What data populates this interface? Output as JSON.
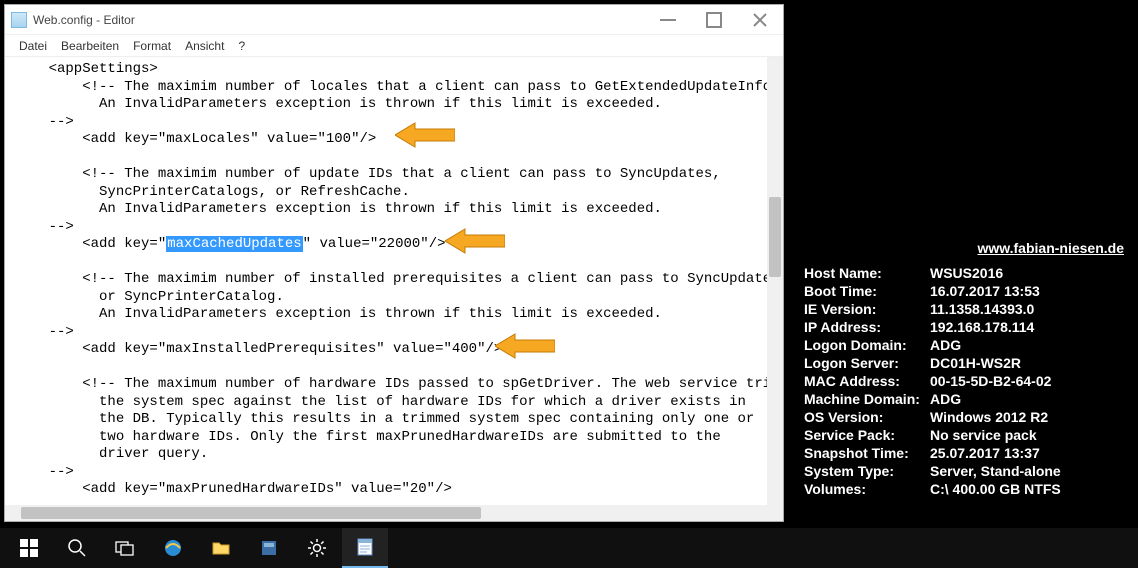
{
  "window": {
    "title": "Web.config - Editor",
    "menu": {
      "datei": "Datei",
      "bearbeiten": "Bearbeiten",
      "format": "Format",
      "ansicht": "Ansicht",
      "help": "?"
    }
  },
  "code": {
    "l1": "    <appSettings>",
    "l2": "        <!-- The maximim number of locales that a client can pass to GetExtendedUpdateInfo.",
    "l3": "          An InvalidParameters exception is thrown if this limit is exceeded.",
    "l4": "    -->",
    "l5a": "        <add key=\"maxLocales\" value=\"",
    "l5b": "100",
    "l5c": "\"/>",
    "l6": "",
    "l7": "        <!-- The maximim number of update IDs that a client can pass to SyncUpdates,",
    "l8": "          SyncPrinterCatalogs, or RefreshCache.",
    "l9": "          An InvalidParameters exception is thrown if this limit is exceeded.",
    "l10": "    -->",
    "l11a": "        <add key=\"",
    "l11b": "maxCachedUpdates",
    "l11c": "\" value=\"",
    "l11d": "22000",
    "l11e": "\"/>",
    "l12": "",
    "l13": "        <!-- The maximim number of installed prerequisites a client can pass to SyncUpdates",
    "l14": "          or SyncPrinterCatalog.",
    "l15": "          An InvalidParameters exception is thrown if this limit is exceeded.",
    "l16": "    -->",
    "l17a": "        <add key=\"maxInstalledPrerequisites\" value=\"",
    "l17b": "400",
    "l17c": "\"/>",
    "l18": "",
    "l19": "        <!-- The maximum number of hardware IDs passed to spGetDriver. The web service trims",
    "l20": "          the system spec against the list of hardware IDs for which a driver exists in",
    "l21": "          the DB. Typically this results in a trimmed system spec containing only one or",
    "l22": "          two hardware IDs. Only the first maxPrunedHardwareIDs are submitted to the",
    "l23": "          driver query.",
    "l24": "    -->",
    "l25": "        <add key=\"maxPrunedHardwareIDs\" value=\"20\"/>"
  },
  "info": {
    "url": "www.fabian-niesen.de",
    "rows": [
      {
        "label": "Host Name:",
        "value": "WSUS2016"
      },
      {
        "label": "Boot Time:",
        "value": "16.07.2017 13:53"
      },
      {
        "label": "IE Version:",
        "value": "11.1358.14393.0"
      },
      {
        "label": "IP Address:",
        "value": "192.168.178.114"
      },
      {
        "label": "Logon Domain:",
        "value": "ADG"
      },
      {
        "label": "Logon Server:",
        "value": "DC01H-WS2R"
      },
      {
        "label": "MAC Address:",
        "value": "00-15-5D-B2-64-02"
      },
      {
        "label": "Machine Domain:",
        "value": "ADG"
      },
      {
        "label": "OS Version:",
        "value": "Windows 2012 R2"
      },
      {
        "label": "Service Pack:",
        "value": "No service pack"
      },
      {
        "label": "Snapshot Time:",
        "value": "25.07.2017 13:37"
      },
      {
        "label": "System Type:",
        "value": "Server, Stand-alone"
      },
      {
        "label": "Volumes:",
        "value": "C:\\ 400.00 GB NTFS"
      }
    ]
  }
}
